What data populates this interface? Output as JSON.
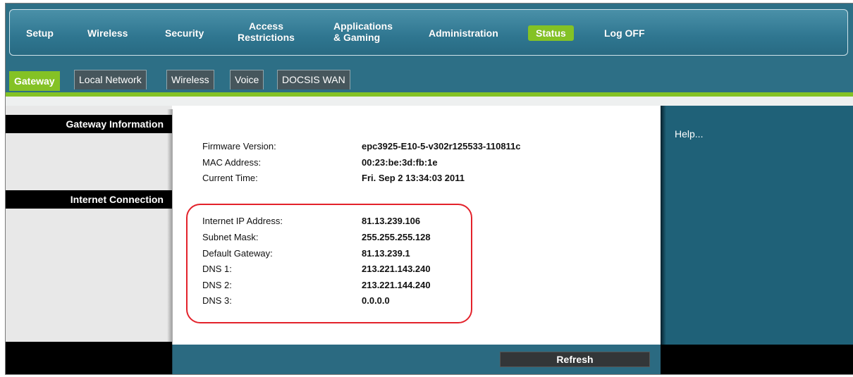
{
  "menu": {
    "setup": "Setup",
    "wireless": "Wireless",
    "security": "Security",
    "access_line1": "Access",
    "access_line2": "Restrictions",
    "apps_line1": "Applications",
    "apps_line2": "& Gaming",
    "administration": "Administration",
    "status": "Status",
    "logoff": "Log OFF",
    "active_color": "#84c225"
  },
  "tabs": {
    "gateway": "Gateway",
    "local_network": "Local Network",
    "wireless": "Wireless",
    "voice": "Voice",
    "docsis_wan": "DOCSIS WAN"
  },
  "sidebar": {
    "gateway_information": "Gateway Information",
    "internet_connection": "Internet Connection"
  },
  "gateway_info": [
    {
      "label": "Firmware Version:",
      "value": "epc3925-E10-5-v302r125533-110811c"
    },
    {
      "label": "MAC Address:",
      "value": "00:23:be:3d:fb:1e"
    },
    {
      "label": "Current Time:",
      "value": "Fri. Sep 2 13:34:03 2011"
    }
  ],
  "internet_connection": [
    {
      "label": "Internet IP Address:",
      "value": "81.13.239.106"
    },
    {
      "label": "Subnet Mask:",
      "value": "255.255.255.128"
    },
    {
      "label": "Default Gateway:",
      "value": "81.13.239.1"
    },
    {
      "label": "DNS 1:",
      "value": "213.221.143.240"
    },
    {
      "label": "DNS 2:",
      "value": "213.221.144.240"
    },
    {
      "label": "DNS 3:",
      "value": "0.0.0.0"
    }
  ],
  "help": {
    "label": "Help..."
  },
  "actions": {
    "refresh": "Refresh"
  }
}
